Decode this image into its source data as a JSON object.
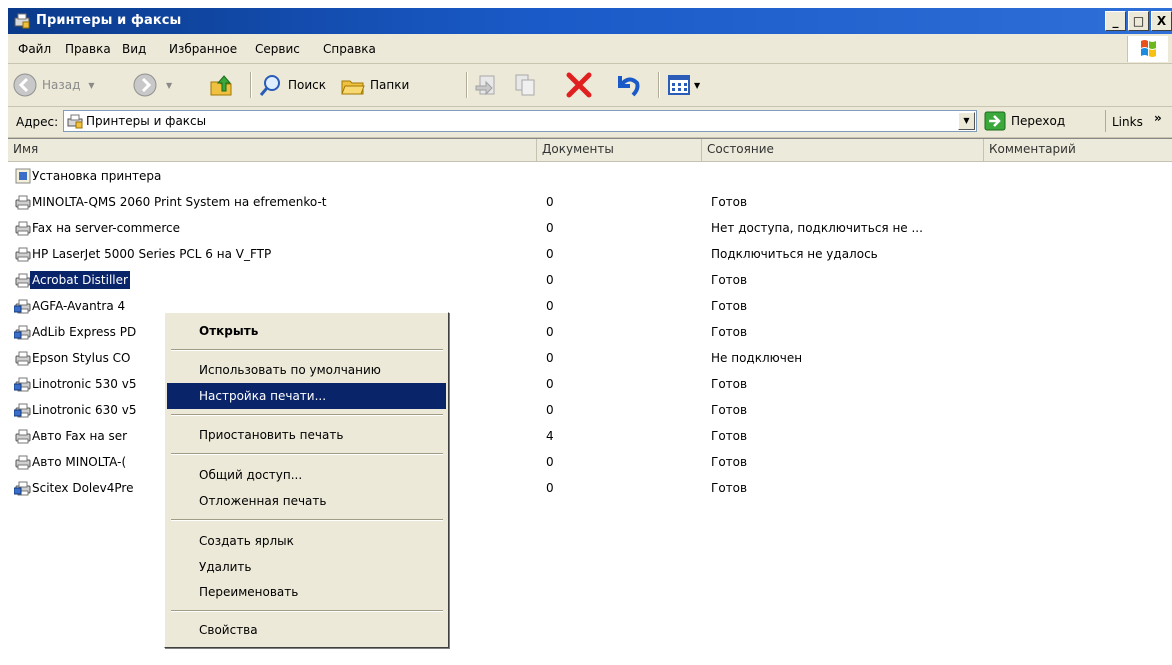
{
  "window": {
    "title": "Принтеры и факсы",
    "buttons": [
      "_",
      "□",
      "X"
    ]
  },
  "menu": [
    "Файл",
    "Правка",
    "Вид",
    "Избранное",
    "Сервис",
    "Справка"
  ],
  "toolbar": {
    "back": "Назад",
    "search": "Поиск",
    "folders": "Папки"
  },
  "address": {
    "label": "Адрес:",
    "value": "Принтеры и факсы",
    "go": "Переход",
    "links": "Links",
    "links_chevron": "»"
  },
  "columns": [
    "Имя",
    "Документы",
    "Состояние",
    "Комментарий"
  ],
  "rows": [
    {
      "name": "Установка принтера",
      "docs": "",
      "status": ""
    },
    {
      "name": "MINOLTA-QMS 2060 Print System на efremenko-t",
      "docs": "0",
      "status": "Готов"
    },
    {
      "name": "Fax на server-commerce",
      "docs": "0",
      "status": "Нет доступа, подключиться не ..."
    },
    {
      "name": "HP LaserJet 5000 Series PCL 6 на V_FTP",
      "docs": "0",
      "status": "Подключиться не удалось"
    },
    {
      "name": "Acrobat Distiller",
      "docs": "0",
      "status": "Готов"
    },
    {
      "name": "AGFA-Avantra 4",
      "docs": "0",
      "status": "Готов"
    },
    {
      "name": "AdLib Express PD",
      "docs": "0",
      "status": "Готов"
    },
    {
      "name": "Epson Stylus CO",
      "docs": "0",
      "status": "Не подключен"
    },
    {
      "name": "Linotronic 530 v5",
      "docs": "0",
      "status": "Готов"
    },
    {
      "name": "Linotronic 630 v5",
      "docs": "0",
      "status": "Готов"
    },
    {
      "name": "Авто Fax на ser",
      "docs": "4",
      "status": "Готов"
    },
    {
      "name": "Авто MINOLTA-(",
      "docs": "0",
      "status": "Готов"
    },
    {
      "name": "Scitex Dolev4Pre",
      "docs": "0",
      "status": "Готов"
    }
  ],
  "context_menu": {
    "open": "Открыть",
    "set_default": "Использовать по умолчанию",
    "print_prefs": "Настройка печати...",
    "pause": "Приостановить печать",
    "sharing": "Общий доступ...",
    "offline": "Отложенная печать",
    "shortcut": "Создать ярлык",
    "delete": "Удалить",
    "rename": "Переименовать",
    "properties": "Свойства"
  },
  "colors": {
    "titlebar": "#1a5ac8",
    "selection": "#0a246a",
    "face": "#ece9d8"
  }
}
